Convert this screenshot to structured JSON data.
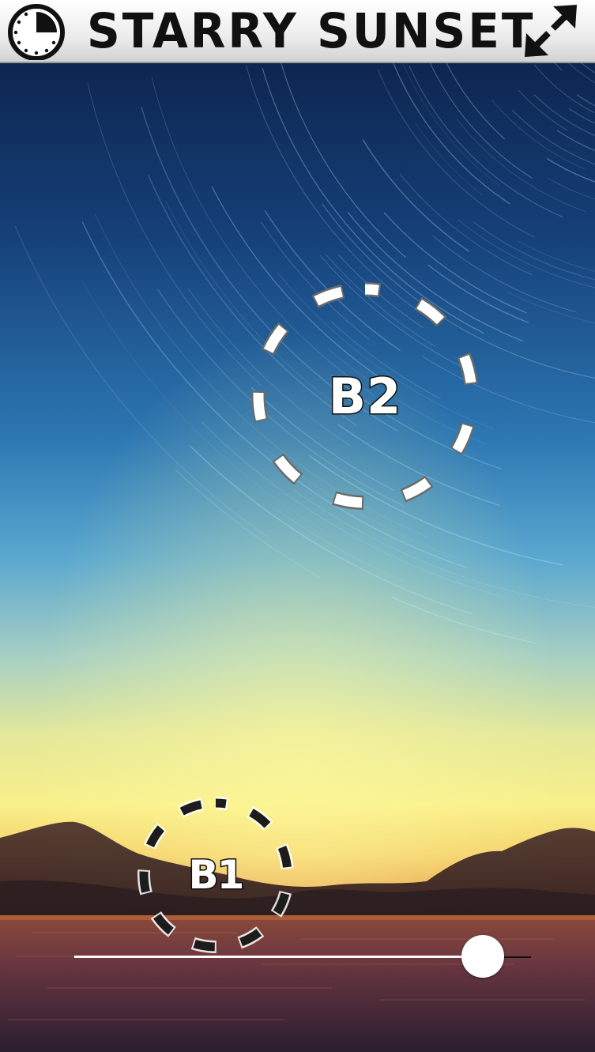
{
  "header": {
    "title": "STARRY SUNSET",
    "timer_icon": "stopwatch-icon",
    "expand_icon": "expand-arrows-icon"
  },
  "targets": [
    {
      "id": "b2",
      "label": "B2",
      "style": "white-dashed-ring"
    },
    {
      "id": "b1",
      "label": "B1",
      "style": "black-dashed-ring"
    }
  ],
  "slider": {
    "value": 0.895
  },
  "colors": {
    "sky_top": "#0e2753",
    "sky_mid": "#4a9fcc",
    "horizon_glow": "#f9ef8c",
    "sunset_orange": "#e6963e",
    "water": "#4a2a35",
    "header_bg": "#eeeeee",
    "title_text": "#111111"
  }
}
